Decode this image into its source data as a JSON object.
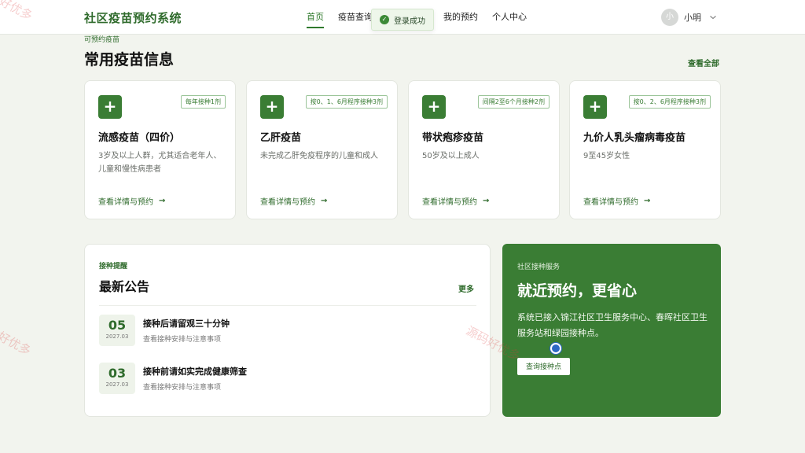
{
  "brand": "社区疫苗预约系统",
  "nav": [
    {
      "label": "首页",
      "active": true
    },
    {
      "label": "疫苗查询",
      "active": false
    },
    {
      "label": "我的预约",
      "active": false
    },
    {
      "label": "个人中心",
      "active": false
    }
  ],
  "toast": {
    "text": "登录成功",
    "icon": "check-circle-icon"
  },
  "user": {
    "avatar": "小",
    "name": "小明"
  },
  "vaccines": {
    "eyebrow": "可预约疫苗",
    "title": "常用疫苗信息",
    "view_all": "查看全部",
    "cards": [
      {
        "name": "流感疫苗（四价）",
        "tag": "每年接种1剂",
        "desc": "3岁及以上人群，尤其适合老年人、儿童和慢性病患者",
        "link": "查看详情与预约"
      },
      {
        "name": "乙肝疫苗",
        "tag": "按0、1、6月程序接种3剂",
        "desc": "未完成乙肝免疫程序的儿童和成人",
        "link": "查看详情与预约"
      },
      {
        "name": "带状疱疹疫苗",
        "tag": "间隔2至6个月接种2剂",
        "desc": "50岁及以上成人",
        "link": "查看详情与预约"
      },
      {
        "name": "九价人乳头瘤病毒疫苗",
        "tag": "按0、2、6月程序接种3剂",
        "desc": "9至45岁女性",
        "link": "查看详情与预约"
      }
    ]
  },
  "notices": {
    "eyebrow": "接种提醒",
    "title": "最新公告",
    "more": "更多",
    "items": [
      {
        "day": "05",
        "ym": "2027.03",
        "title": "接种后请留观三十分钟",
        "sub": "查看接种安排与注意事项"
      },
      {
        "day": "03",
        "ym": "2027.03",
        "title": "接种前请如实完成健康筛查",
        "sub": "查看接种安排与注意事项"
      }
    ]
  },
  "service": {
    "eyebrow": "社区接种服务",
    "title": "就近预约，更省心",
    "desc": "系统已接入锦江社区卫生服务中心、春晖社区卫生服务站和绿园接种点。",
    "button": "查询接种点"
  },
  "watermarks": [
    "好优多",
    "源码好优多",
    "好优多"
  ],
  "colors": {
    "accent": "#3a7d34",
    "background": "#f2f4ee"
  }
}
